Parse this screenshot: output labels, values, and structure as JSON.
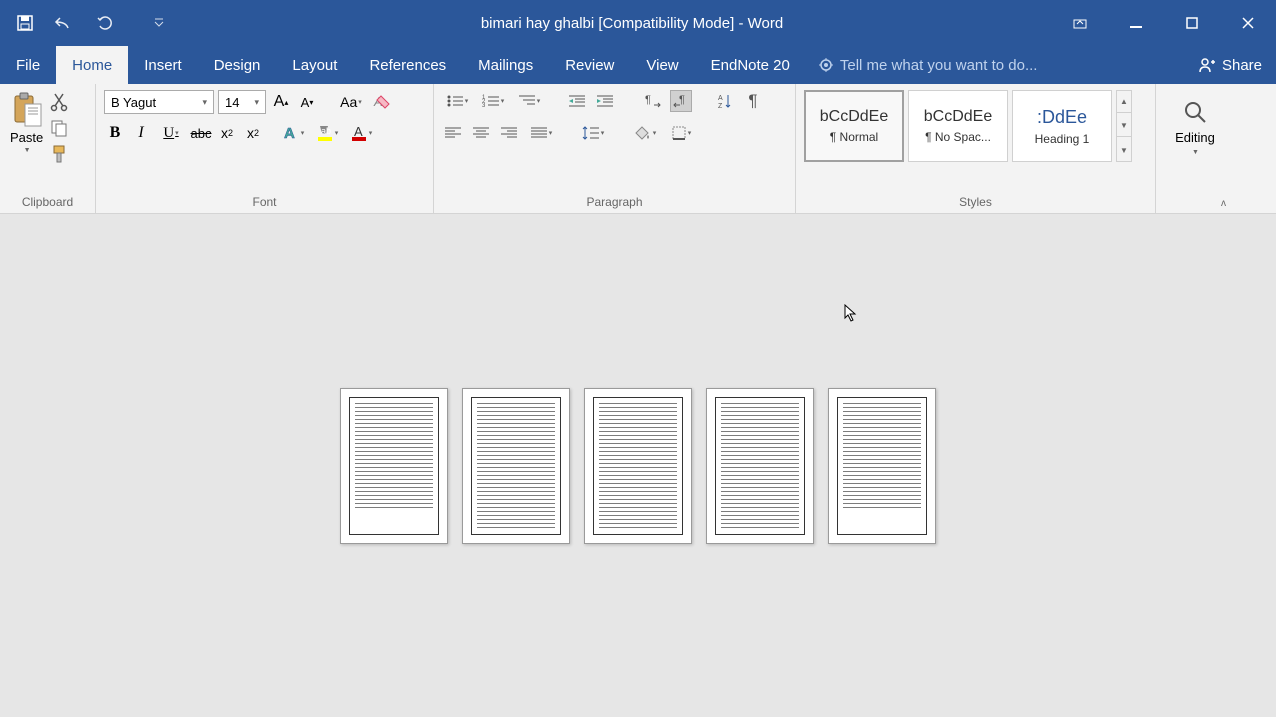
{
  "titlebar": {
    "document_title": "bimari hay ghalbi [Compatibility Mode] - Word"
  },
  "menu": {
    "file": "File",
    "home": "Home",
    "insert": "Insert",
    "design": "Design",
    "layout": "Layout",
    "references": "References",
    "mailings": "Mailings",
    "review": "Review",
    "view": "View",
    "endnote": "EndNote 20",
    "tellme_placeholder": "Tell me what you want to do...",
    "share": "Share"
  },
  "ribbon": {
    "clipboard": {
      "label": "Clipboard",
      "paste": "Paste"
    },
    "font": {
      "label": "Font",
      "font_name": "B Yagut",
      "font_size": "14",
      "change_case": "Aa"
    },
    "paragraph": {
      "label": "Paragraph"
    },
    "styles": {
      "label": "Styles",
      "normal_preview": "bCcDdEe",
      "normal_name": "¶ Normal",
      "nospac_preview": "bCcDdEe",
      "nospac_name": "¶ No Spac...",
      "heading1_preview": ":DdEe",
      "heading1_name": "Heading 1"
    },
    "editing": {
      "label": "Editing"
    }
  }
}
